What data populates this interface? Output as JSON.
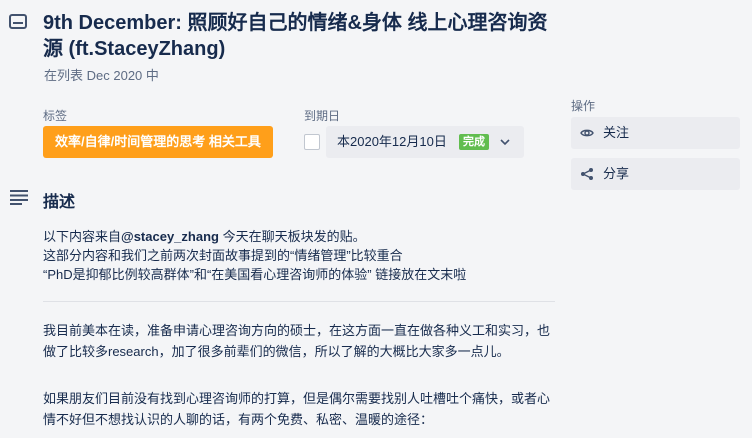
{
  "card": {
    "title": "9th December: 照顾好自己的情绪&身体 线上心理咨询资源 (ft.StaceyZhang)",
    "in_list_prefix": "在列表",
    "list_name": "Dec 2020",
    "in_list_suffix": "中"
  },
  "labels": {
    "heading": "标签",
    "items": [
      "效率/自律/时间管理的思考 相关工具"
    ],
    "color": "#ff9f1a"
  },
  "due": {
    "heading": "到期日",
    "date": "本2020年12月10日",
    "status": "完成",
    "status_color": "#61bd4f"
  },
  "description": {
    "heading": "描述",
    "line1_prefix": "以下内容来自",
    "line1_user": "@stacey_zhang",
    "line1_suffix": " 今天在聊天板块发的贴。",
    "line2": "这部分内容和我们之前两次封面故事提到的“情绪管理”比较重合",
    "line3": "“PhD是抑郁比例较高群体”和“在美国看心理咨询师的体验” 链接放在文末啦",
    "para1": "我目前美本在读，准备申请心理咨询方向的硕士，在这方面一直在做各种义工和实习，也做了比较多research，加了很多前辈们的微信，所以了解的大概比大家多一点儿。",
    "para2": "如果朋友们目前没有找到心理咨询师的打算，但是偶尔需要找别人吐槽吐个痛快，或者心情不好但不想找认识的人聊的话，有两个免费、私密、温暖的途径："
  },
  "actions": {
    "heading": "操作",
    "watch": "关注",
    "share": "分享"
  },
  "icons": {
    "card": "card-icon",
    "description": "description-lines-icon",
    "watch": "eye-icon",
    "share": "share-icon",
    "due_dropdown": "chevron-down-icon"
  }
}
